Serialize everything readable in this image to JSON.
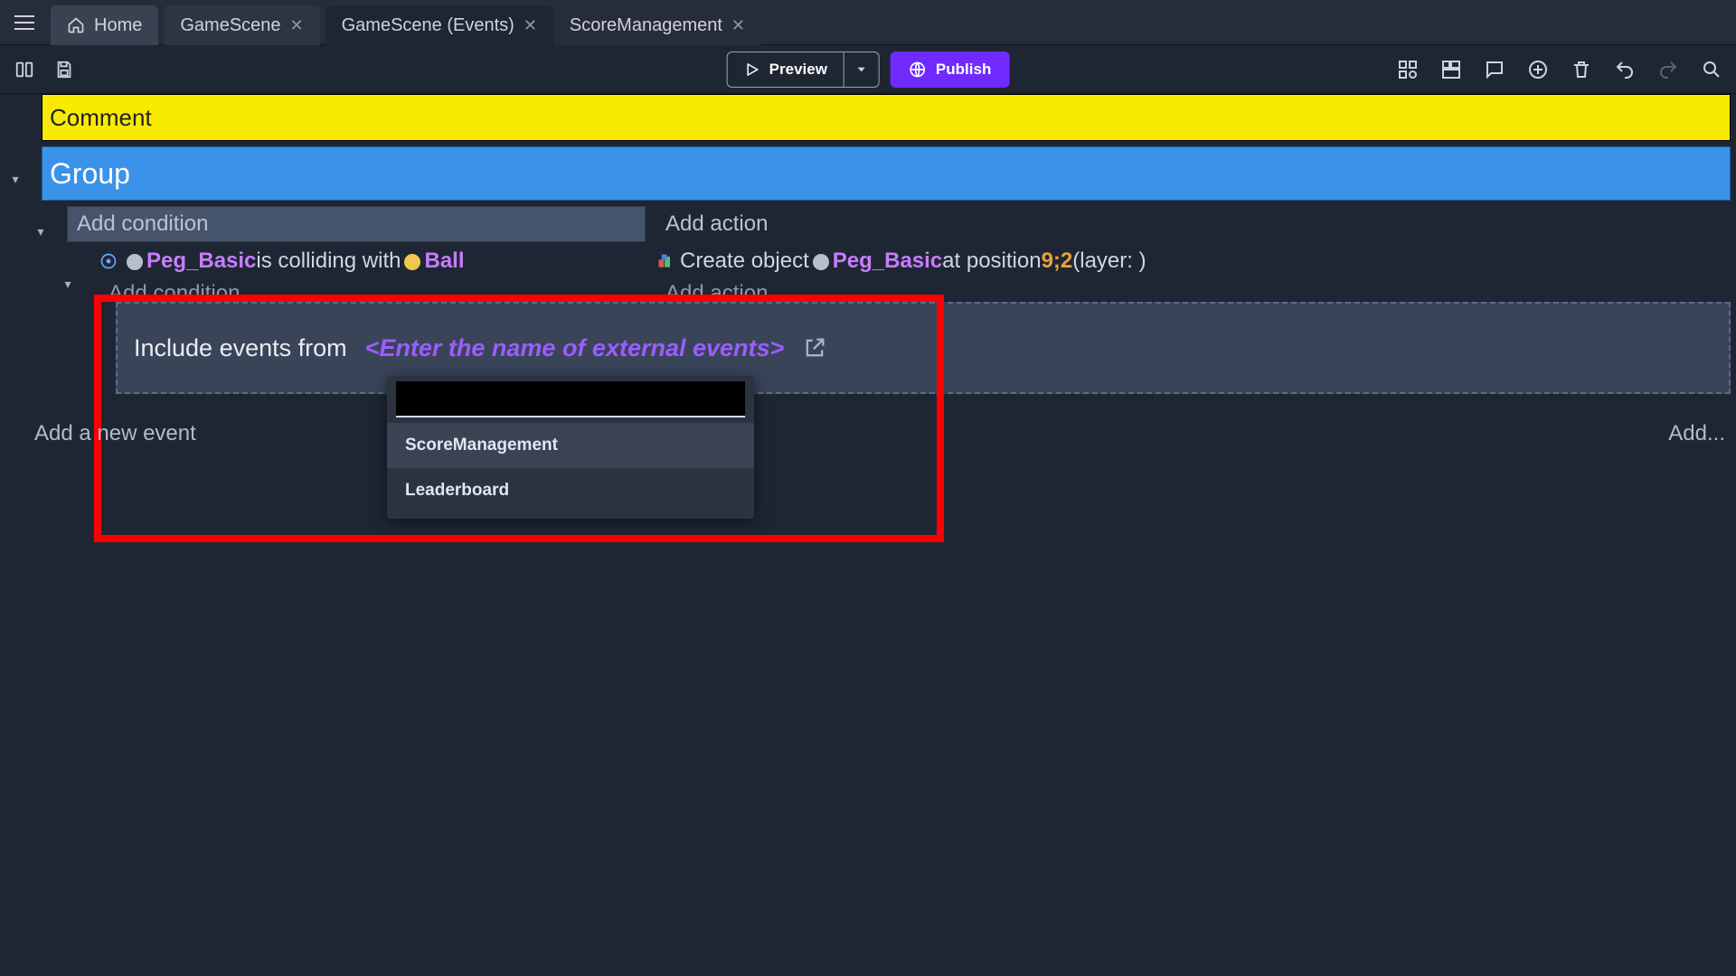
{
  "tabs": {
    "home": "Home",
    "scene": "GameScene",
    "events": "GameScene (Events)",
    "ext": "ScoreManagement"
  },
  "toolbar": {
    "preview": "Preview",
    "publish": "Publish"
  },
  "events": {
    "comment": "Comment",
    "group": "Group",
    "add_condition": "Add condition",
    "add_action": "Add action",
    "cond_obj1": "Peg_Basic",
    "cond_mid": " is colliding with ",
    "cond_obj2": "Ball",
    "act_prefix": "Create object ",
    "act_obj": "Peg_Basic",
    "act_mid": " at position ",
    "act_pos": "9;2",
    "act_suffix": " (layer: )",
    "add_condition2": "Add condition",
    "add_action2": "Add action",
    "include_lead": "Include events from",
    "include_placeholder": "<Enter the name of external events>",
    "add_new_event": "Add a new event",
    "add_right": "Add..."
  },
  "dropdown": {
    "opt1": "ScoreManagement",
    "opt2": "Leaderboard"
  }
}
